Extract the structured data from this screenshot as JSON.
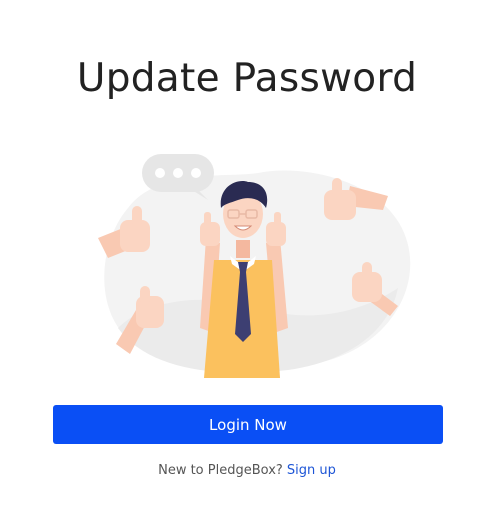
{
  "page": {
    "title": "Update Password"
  },
  "illustration": {
    "description_icon": "thumbs-up-person-illustration",
    "chat_bubble_icon": "chat-bubble-icon"
  },
  "actions": {
    "login_label": "Login Now"
  },
  "signup": {
    "prompt": "New to PledgeBox?",
    "link_label": "Sign up"
  },
  "colors": {
    "primary": "#0a4ff5",
    "link": "#1d55d6",
    "title": "#222222",
    "shirt": "#fbc15e",
    "tie": "#3d3f72",
    "skin": "#f9c9b2",
    "hair": "#2a2b52",
    "blob": "#f3f3f3"
  }
}
